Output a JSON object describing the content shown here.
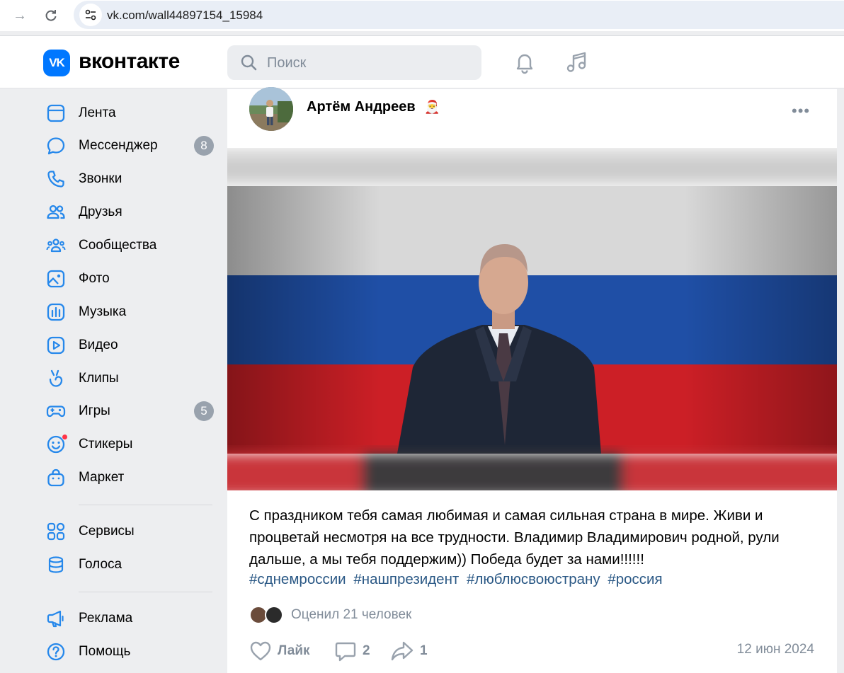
{
  "browser": {
    "url": "vk.com/wall44897154_15984"
  },
  "header": {
    "logo_mark": "VK",
    "logo_text": "вконтакте",
    "search_placeholder": "Поиск"
  },
  "sidebar": {
    "items": [
      {
        "label": "Лента",
        "icon": "feed-icon"
      },
      {
        "label": "Мессенджер",
        "icon": "messenger-icon",
        "badge": "8"
      },
      {
        "label": "Звонки",
        "icon": "phone-icon"
      },
      {
        "label": "Друзья",
        "icon": "friends-icon"
      },
      {
        "label": "Сообщества",
        "icon": "communities-icon"
      },
      {
        "label": "Фото",
        "icon": "photo-icon"
      },
      {
        "label": "Музыка",
        "icon": "music-icon"
      },
      {
        "label": "Видео",
        "icon": "video-icon"
      },
      {
        "label": "Клипы",
        "icon": "clips-icon"
      },
      {
        "label": "Игры",
        "icon": "games-icon",
        "badge": "5"
      },
      {
        "label": "Стикеры",
        "icon": "stickers-icon"
      },
      {
        "label": "Маркет",
        "icon": "market-icon"
      },
      {
        "label": "Сервисы",
        "icon": "services-icon"
      },
      {
        "label": "Голоса",
        "icon": "votes-icon"
      },
      {
        "label": "Реклама",
        "icon": "ads-icon"
      },
      {
        "label": "Помощь",
        "icon": "help-icon"
      }
    ]
  },
  "post": {
    "author": "Артём Андреев",
    "author_emoji": "🎅",
    "more": "•••",
    "text": "С праздником тебя самая любимая и самая сильная страна в мире. Живи и процветай несмотря на все трудности. Владимир Владимирович родной, рули дальше, а мы тебя поддержим)) Победа будет за нами!!!!!!",
    "hashtags": [
      "#сднемроссии",
      "#нашпрезидент",
      "#люблюсвоюстрану",
      "#россия"
    ],
    "rated_by": "Оценил 21 человек",
    "like_label": "Лайк",
    "comments_count": "2",
    "shares_count": "1",
    "date": "12 июн 2024"
  },
  "colors": {
    "accent": "#0077ff",
    "link": "#2a5885",
    "muted": "#818c99",
    "icon": "#2688eb",
    "flag_white": "#e8e8e8",
    "flag_blue": "#1f4fa6",
    "flag_red": "#cc1f26"
  }
}
